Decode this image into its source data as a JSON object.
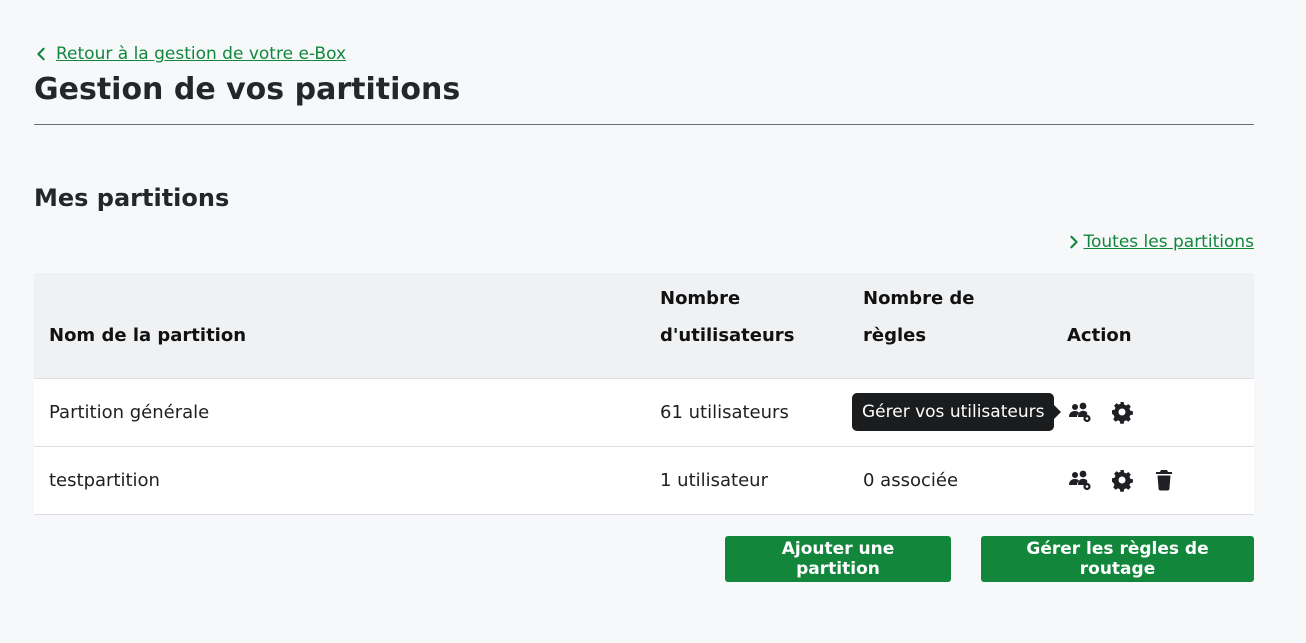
{
  "nav": {
    "back_label": "Retour à la gestion de votre e-Box"
  },
  "page": {
    "title": "Gestion de vos partitions"
  },
  "section": {
    "title": "Mes partitions",
    "all_link_label": "Toutes les partitions"
  },
  "table": {
    "headers": {
      "name": "Nom de la partition",
      "users_line1": "Nombre",
      "users_line2": "d'utilisateurs",
      "rules": "Nombre de règles",
      "action": "Action"
    },
    "rows": [
      {
        "name": "Partition générale",
        "users": "61 utilisateurs",
        "rules": "",
        "actions": [
          "users-gear-icon",
          "gear-icon"
        ]
      },
      {
        "name": "testpartition",
        "users": "1 utilisateur",
        "rules": "0 associée",
        "actions": [
          "users-gear-icon",
          "gear-icon",
          "trash-icon"
        ]
      }
    ]
  },
  "tooltip": {
    "text": "Gérer vos utilisateurs"
  },
  "buttons": {
    "add_partition": "Ajouter une partition",
    "manage_rules": "Gérer les règles de routage"
  },
  "colors": {
    "accent": "#12873c",
    "background": "#f7f8fa",
    "header_bg": "#f0f1f3",
    "tooltip_bg": "#1b1c1e"
  }
}
